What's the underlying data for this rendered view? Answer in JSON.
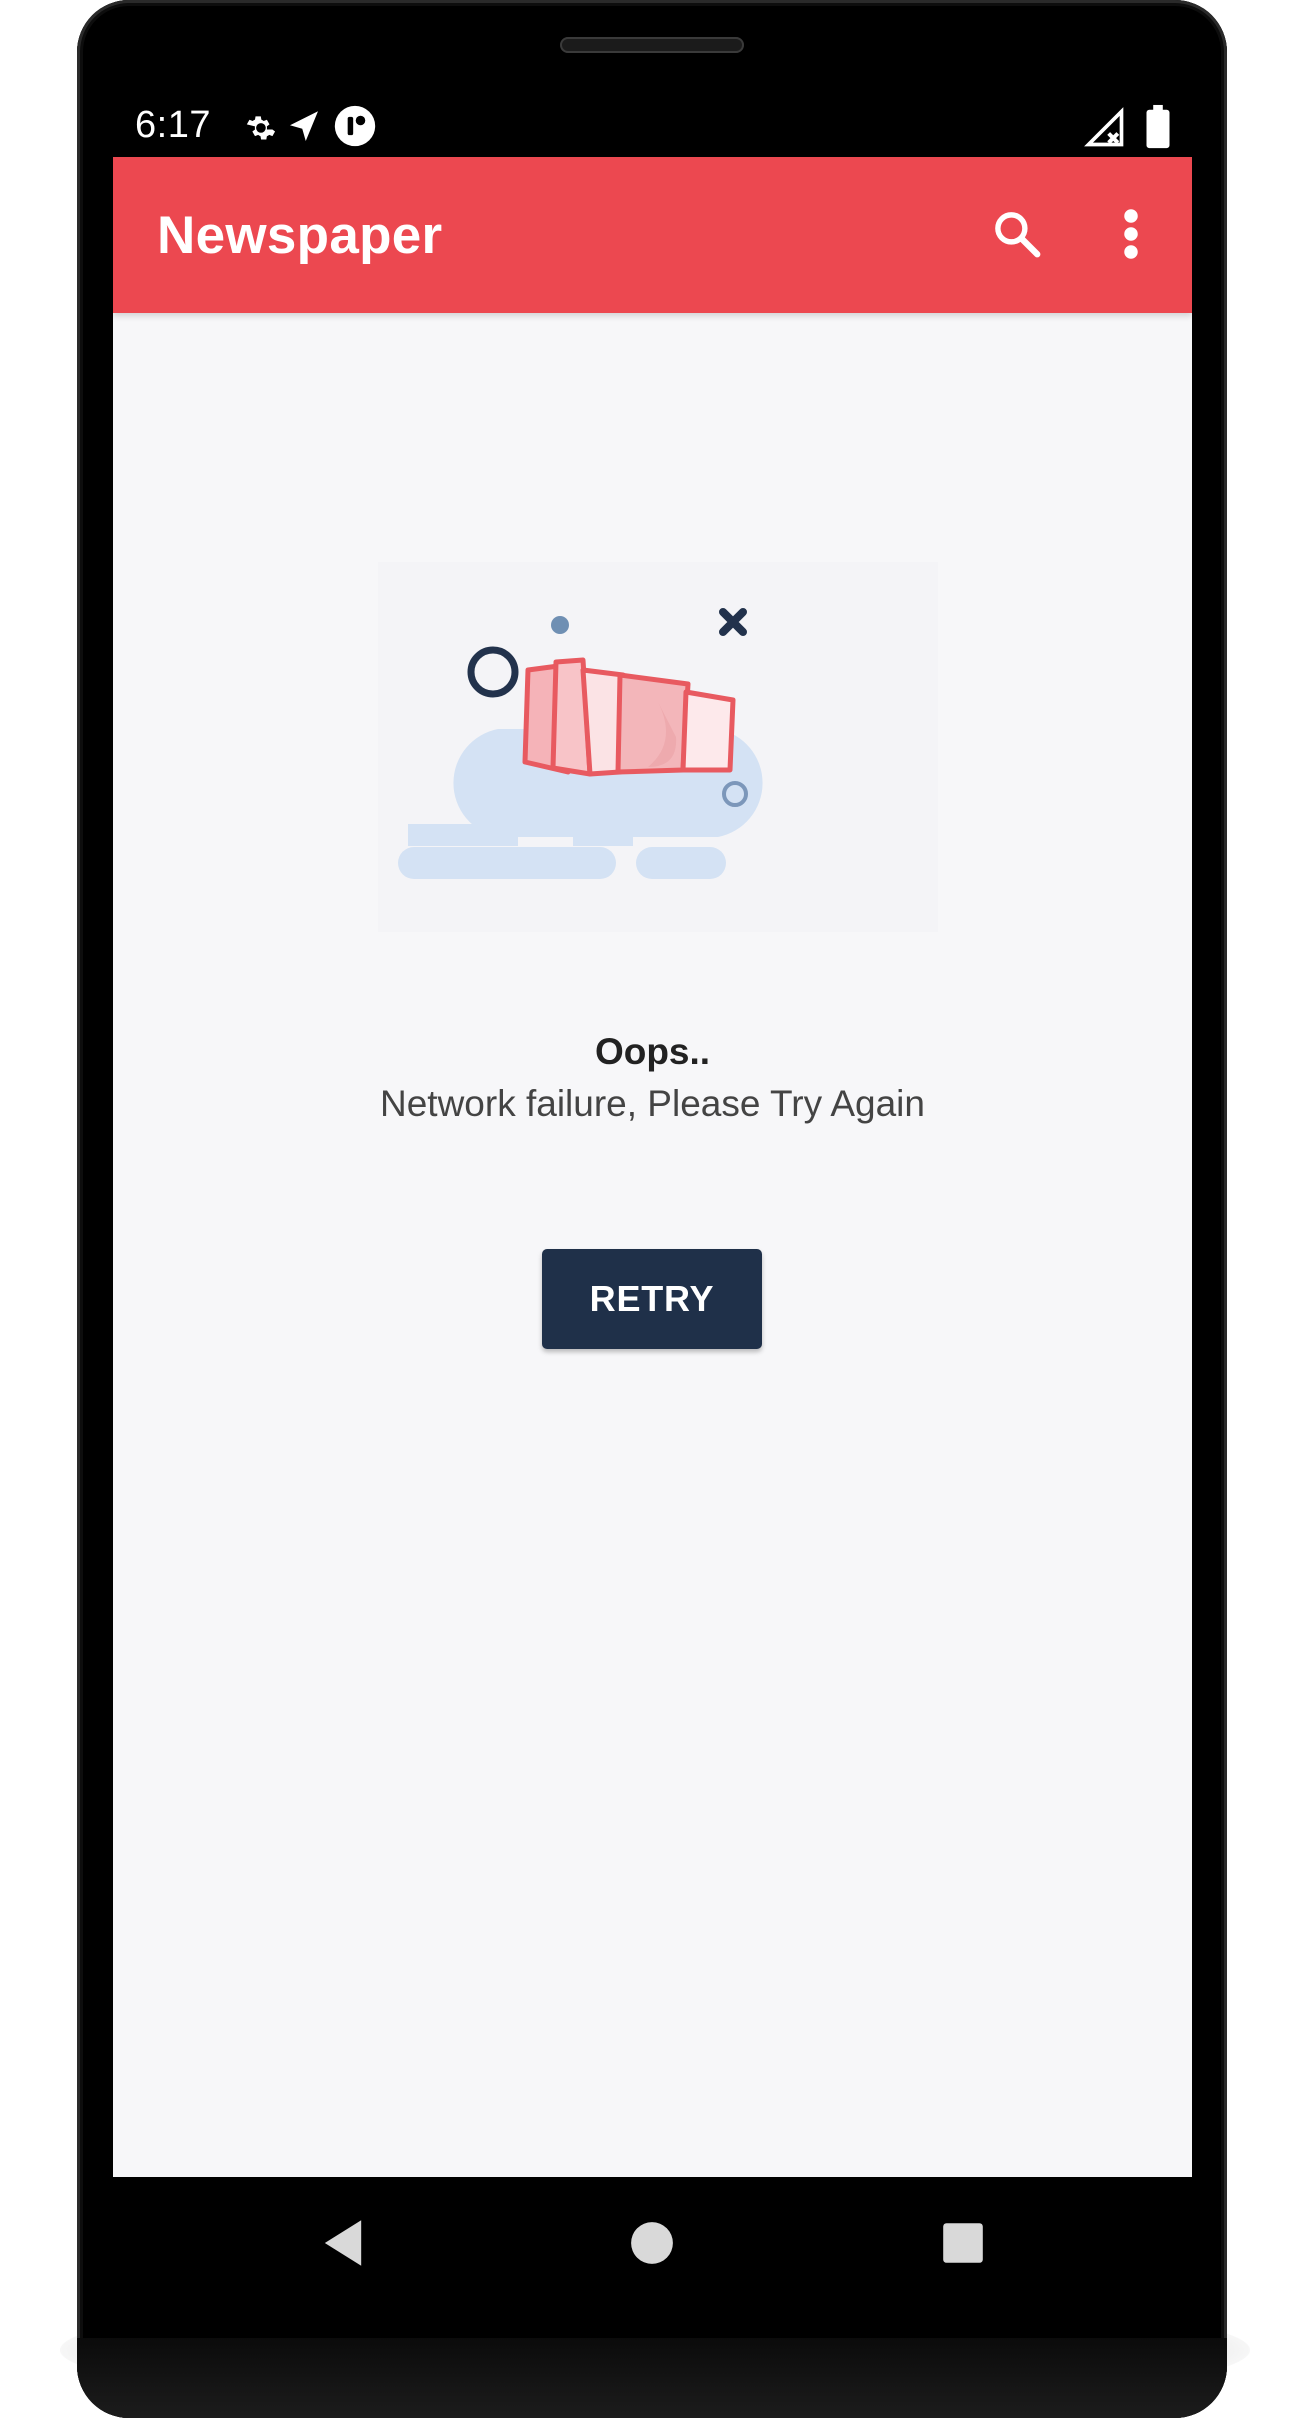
{
  "status_bar": {
    "time": "6:17",
    "icons": [
      "settings-icon",
      "location-icon",
      "app-notification-icon",
      "signal-no-service-icon",
      "battery-icon"
    ]
  },
  "app_bar": {
    "title": "Newspaper",
    "actions": [
      "search-icon",
      "more-vert-icon"
    ],
    "background_color": "#ec4850"
  },
  "error_state": {
    "illustration": "broken-newspaper-illustration",
    "title": "Oops..",
    "message": "Network failure, Please Try Again",
    "retry_label": "RETRY",
    "button_color": "#1f3049"
  },
  "nav_bar": {
    "buttons": [
      "back-icon",
      "home-icon",
      "recents-icon"
    ]
  }
}
